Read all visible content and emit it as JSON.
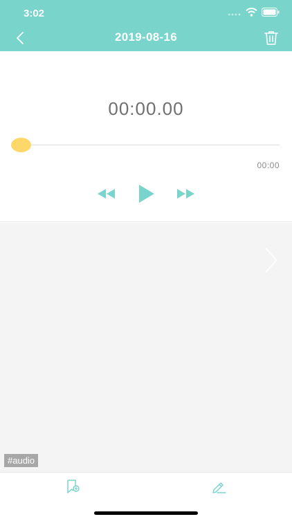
{
  "status_bar": {
    "time": "3:02"
  },
  "header": {
    "title": "2019-08-16"
  },
  "player": {
    "current_time": "00:00.00",
    "duration": "00:00",
    "progress": 0
  },
  "note": {
    "tag": "#audio"
  },
  "colors": {
    "accent": "#79d5cb",
    "knob": "#fcd86a",
    "content_bg": "#f4f4f4",
    "tag_bg": "#a7a7a7"
  },
  "icons": {
    "back": "chevron-left-icon",
    "trash": "trash-icon",
    "rewind": "rewind-icon",
    "play": "play-icon",
    "fast_forward": "fast-forward-icon",
    "next": "chevron-right-icon",
    "bookmark": "bookmark-add-icon",
    "edit": "pencil-icon"
  }
}
